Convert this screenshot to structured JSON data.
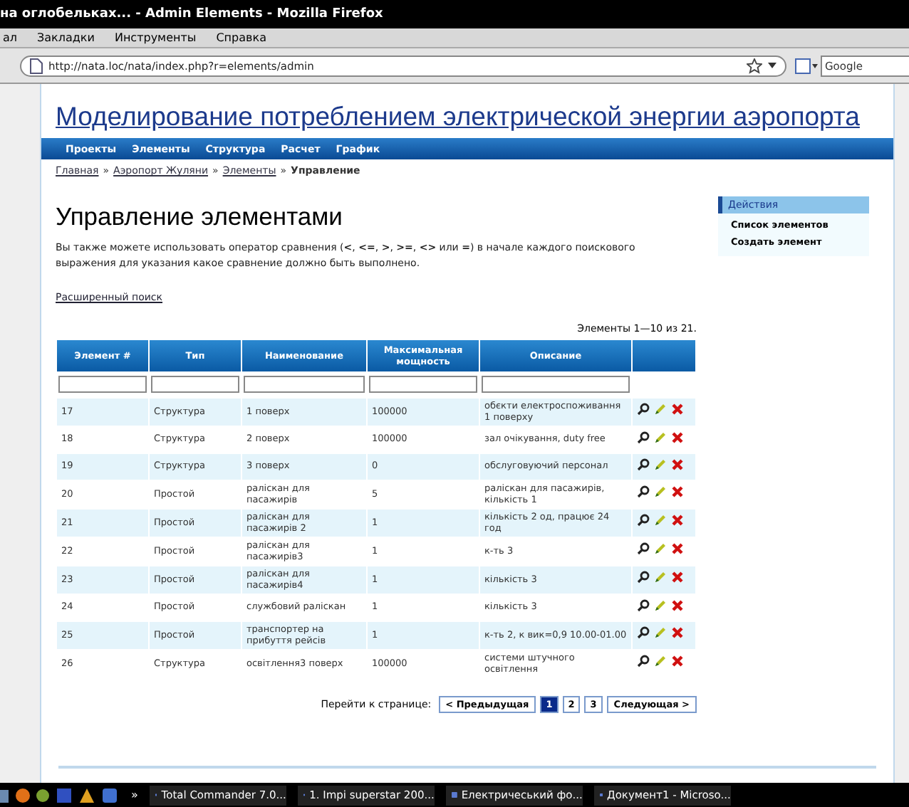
{
  "window": {
    "title": "на оглобельках... - Admin Elements - Mozilla Firefox"
  },
  "menu": [
    "ал",
    "Закладки",
    "Инструменты",
    "Справка"
  ],
  "address_bar": {
    "url": "http://nata.loc/nata/index.php?r=elements/admin"
  },
  "search": {
    "placeholder": "Google"
  },
  "site_title": "Моделирование потреблением электрической энергии аэропорта",
  "nav": [
    "Проекты",
    "Элементы",
    "Структура",
    "Расчет",
    "График"
  ],
  "breadcrumbs": [
    {
      "label": "Главная",
      "link": true
    },
    {
      "separator": "»",
      "label": "Аэропорт Жуляни",
      "link": true
    },
    {
      "separator": "»",
      "label": "Элементы",
      "link": true
    },
    {
      "separator": "»",
      "label": "Управление",
      "link": false
    }
  ],
  "heading": "Управление элементами",
  "hint": "Вы также можете использовать оператор сравнения (**<**, **<=**, **>**, **>=**, **<>** или **=**) в начале каждого поискового выражения для указания какое сравнение должно быть выполнено.",
  "advanced_search": "Расширенный поиск",
  "summary": "Элементы 1—10 из 21.",
  "table": {
    "columns": [
      "Элемент #",
      "Тип",
      "Наименование",
      "Максимальная мощность",
      "Описание"
    ],
    "rows": [
      [
        "17",
        "Структура",
        "1 поверх",
        "100000",
        "обєкти електроспоживання 1 поверху"
      ],
      [
        "18",
        "Структура",
        "2 поверх",
        "100000",
        "зал очікування, duty free"
      ],
      [
        "19",
        "Структура",
        "3 поверх",
        "0",
        "обслуговуючий персонал"
      ],
      [
        "20",
        "Простой",
        "раліскан для пасажирів",
        "5",
        "раліскан для пасажирів, кількість 1"
      ],
      [
        "21",
        "Простой",
        "раліскан для пасажирів 2",
        "1",
        "кількість 2 од, працює 24 год"
      ],
      [
        "22",
        "Простой",
        "раліскан для пасажирів3",
        "1",
        "к-ть 3"
      ],
      [
        "23",
        "Простой",
        "раліскан для пасажирів4",
        "1",
        "кількість 3"
      ],
      [
        "24",
        "Простой",
        "службовий раліскан",
        "1",
        "кількість 3"
      ],
      [
        "25",
        "Простой",
        "транспортер на прибуття рейсів",
        "1",
        "к-ть 2, к вик=0,9 10.00-01.00"
      ],
      [
        "26",
        "Структура",
        "освітлення3 поверх",
        "100000",
        "системи штучного освітлення"
      ]
    ]
  },
  "pager": {
    "label": "Перейти к странице:",
    "prev": "< Предыдущая",
    "next": "Следующая >",
    "pages": [
      {
        "label": "1",
        "selected": true
      },
      {
        "label": "2",
        "selected": false
      },
      {
        "label": "3",
        "selected": false
      }
    ]
  },
  "sidebar": {
    "title": "Действия",
    "items": [
      "Список элементов",
      "Создать элемент"
    ]
  },
  "taskbar": {
    "more": "»",
    "tasks": [
      "Total Commander 7.0...",
      "1. Impi superstar 200...",
      "Електричеський фо...",
      "Документ1 - Microso..."
    ]
  }
}
